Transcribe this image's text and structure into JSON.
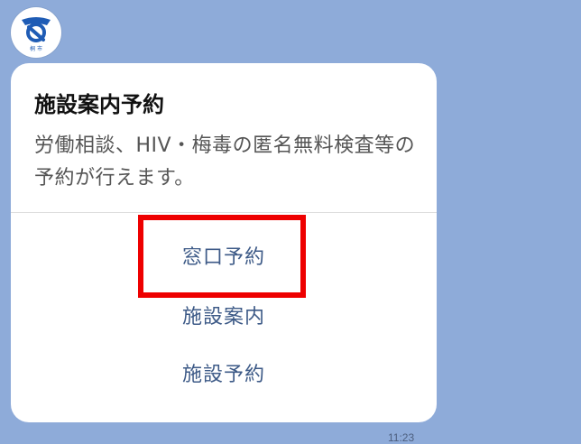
{
  "chat": {
    "background_color": "#8eabd9",
    "avatar": {
      "icon": "municipal-emblem-icon",
      "caption": "桐 市"
    },
    "message": {
      "title": "施設案内予約",
      "description": "労働相談、HIV・梅毒の匿名無料検査等の予約が行えます。",
      "actions": [
        {
          "label": "窓口予約"
        },
        {
          "label": "施設案内"
        },
        {
          "label": "施設予約"
        }
      ],
      "highlighted_action": "窓口予約"
    },
    "timestamp": "11:23"
  },
  "colors": {
    "action_text": "#3d5a87",
    "highlight_border": "#ee0000",
    "emblem_blue": "#1f5cb5"
  }
}
